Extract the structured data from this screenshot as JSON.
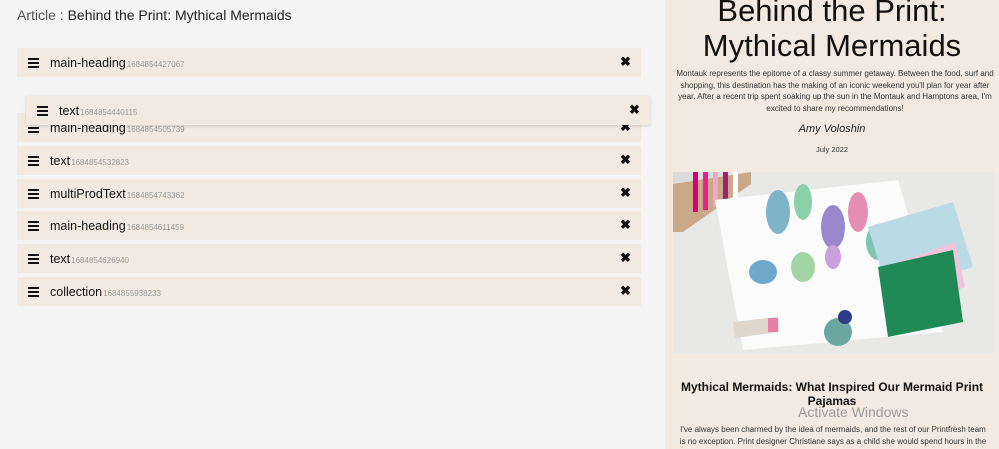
{
  "header": {
    "label": "Article :",
    "title": "Behind the Print: Mythical Mermaids"
  },
  "rows": [
    {
      "name": "main-heading",
      "id": "1684854427067"
    },
    {
      "name": "text",
      "id": "1684854440115"
    },
    {
      "name": "main-heading",
      "id": "1684854505739"
    },
    {
      "name": "text",
      "id": "1684854532823"
    },
    {
      "name": "multiProdText",
      "id": "1684854743362"
    },
    {
      "name": "main-heading",
      "id": "1684854611459"
    },
    {
      "name": "text",
      "id": "1684854626940"
    },
    {
      "name": "collection",
      "id": "1684855938233"
    }
  ],
  "close_glyph": "✖",
  "preview": {
    "title": "Behind the Print: Mythical Mermaids",
    "intro": "Montauk represents the epitome of a classy summer getaway. Between the food, surf and shopping, this destination has the making of an iconic weekend you'll plan for year after year. After a recent trip spent soaking up the sun in the Montauk and Hamptons area, I'm excited to share my recommendations!",
    "author": "Amy Voloshin",
    "date": "July 2022",
    "heading": "Mythical Mermaids: What Inspired Our Mermaid Print Pajamas",
    "body": "I've always been charmed by the idea of mermaids, and the rest of our Printfresh team is no exception. Print designer Christiane says as a child she would spend hours in the pool or the"
  },
  "watermark": "Activate Windows",
  "colors": {
    "row_bg": "#f2eae0",
    "preview_bg": "#f2eae0",
    "page_bg": "#f4f4f4"
  }
}
